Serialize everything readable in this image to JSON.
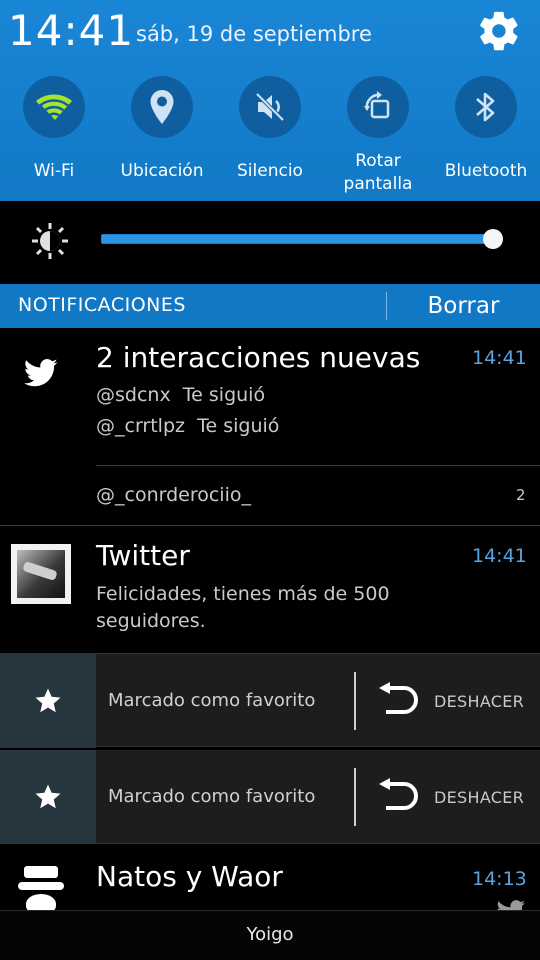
{
  "status": {
    "time": "14:41",
    "date": "sáb, 19 de septiembre"
  },
  "quick_settings": [
    {
      "label": "Wi-Fi",
      "icon": "wifi-icon",
      "active": true
    },
    {
      "label": "Ubicación",
      "icon": "location-icon",
      "active": false
    },
    {
      "label": "Silencio",
      "icon": "mute-icon",
      "active": false
    },
    {
      "label_line1": "Rotar",
      "label_line2": "pantalla",
      "icon": "rotate-screen-icon",
      "active": false
    },
    {
      "label": "Bluetooth",
      "icon": "bluetooth-icon",
      "active": false
    }
  ],
  "brightness": {
    "level": 0.99
  },
  "notifications_header": {
    "title": "NOTIFICACIONES",
    "clear_label": "Borrar"
  },
  "notifications": {
    "interactions": {
      "title": "2 interacciones nuevas",
      "time": "14:41",
      "lines": [
        {
          "user": "@sdcnx",
          "action": "Te siguió"
        },
        {
          "user": "@_crrtlpz",
          "action": "Te siguió"
        }
      ],
      "footer_account": "@_conrderociio_",
      "footer_count": "2"
    },
    "twitter": {
      "title": "Twitter",
      "time": "14:41",
      "text_line1": "Felicidades, tienes más de 500",
      "text_line2": "seguidores."
    },
    "favorites": [
      {
        "text": "Marcado como favorito",
        "undo_label": "DESHACER"
      },
      {
        "text": "Marcado como favorito",
        "undo_label": "DESHACER"
      }
    ],
    "natos": {
      "title": "Natos y Waor",
      "time": "14:13"
    }
  },
  "carrier": "Yoigo",
  "colors": {
    "accent": "#1178c6",
    "wifi_active": "#a6e22e",
    "time_text": "#5aa3e0"
  }
}
